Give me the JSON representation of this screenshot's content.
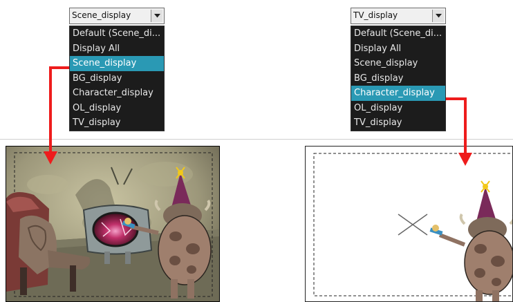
{
  "left_dropdown": {
    "value": "Scene_display",
    "options": [
      "Default (Scene_di...",
      "Display All",
      "Scene_display",
      "BG_display",
      "Character_display",
      "OL_display",
      "TV_display"
    ],
    "selected_index": 2
  },
  "right_dropdown": {
    "value": "TV_display",
    "options": [
      "Default (Scene_di...",
      "Display All",
      "Scene_display",
      "BG_display",
      "Character_display",
      "OL_display",
      "TV_display"
    ],
    "selected_index": 4
  },
  "colors": {
    "highlight": "#2a99b4",
    "list_bg": "#1c1c1c",
    "arrow": "#ee1c1c"
  },
  "icons": [
    "chevron-down-icon"
  ]
}
